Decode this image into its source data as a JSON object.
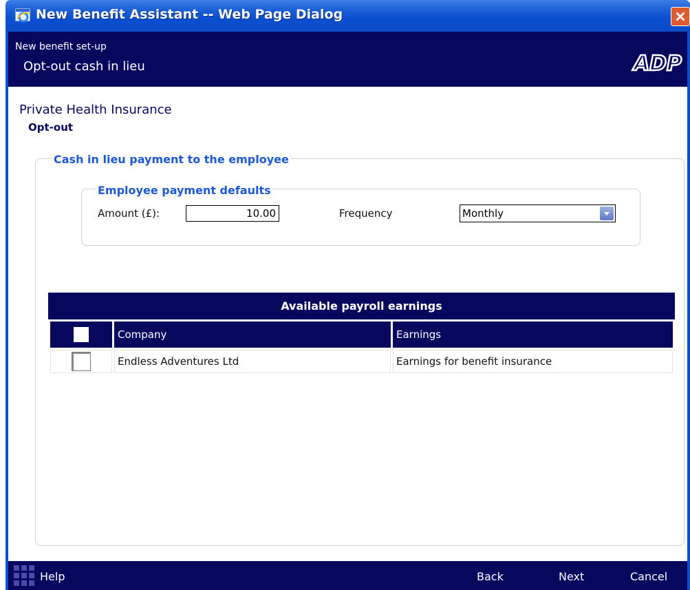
{
  "window": {
    "title": "New Benefit Assistant -- Web Page Dialog"
  },
  "header": {
    "subtitle": "New benefit set-up",
    "title": "Opt-out cash in lieu",
    "logo_text": "ADP"
  },
  "section": {
    "title": "Private Health Insurance",
    "subtitle": "Opt-out"
  },
  "cash_group": {
    "legend": "Cash in lieu payment to the employee"
  },
  "defaults_group": {
    "legend": "Employee payment defaults",
    "amount_label": "Amount (£):",
    "amount_value": "10.00",
    "frequency_label": "Frequency",
    "frequency_value": "Monthly"
  },
  "earnings_table": {
    "caption": "Available payroll earnings",
    "columns": [
      "",
      "Company",
      "Earnings"
    ],
    "rows": [
      {
        "checked": false,
        "company": "Endless Adventures Ltd",
        "earnings": "Earnings for benefit insurance"
      }
    ]
  },
  "footer": {
    "help": "Help",
    "back": "Back",
    "next": "Next",
    "cancel": "Cancel"
  },
  "colors": {
    "navy": "#07075e",
    "titlebar_blue": "#0a4fd0",
    "legend_blue": "#1d59d6",
    "close_red": "#d6431c"
  }
}
